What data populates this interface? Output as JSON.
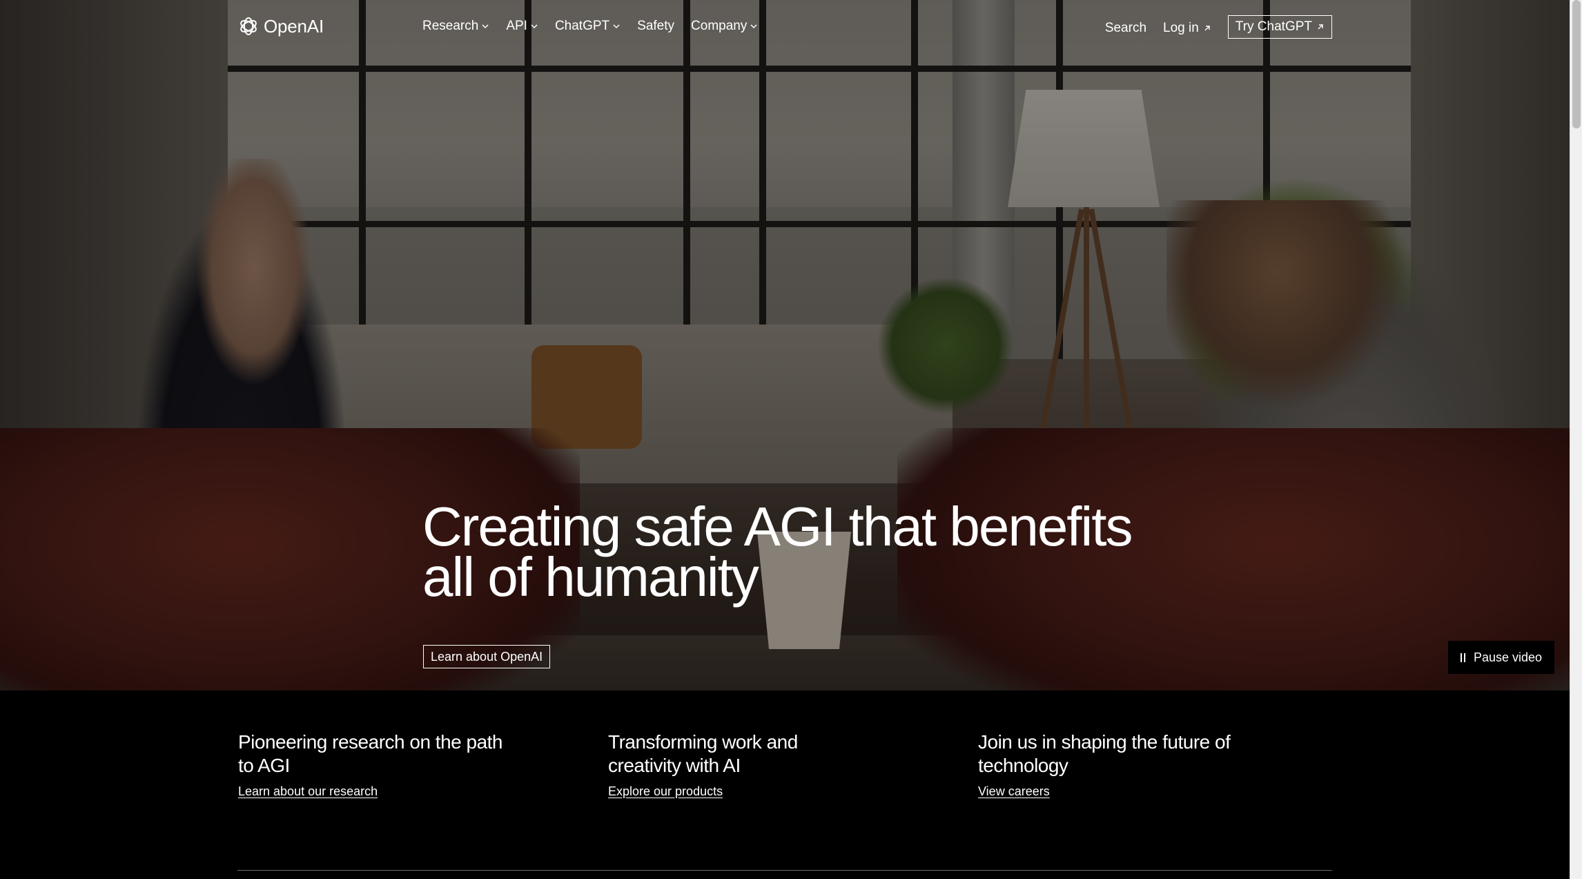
{
  "brand": {
    "name": "OpenAI",
    "logo_icon": "openai-knot-icon"
  },
  "nav": {
    "items": [
      {
        "label": "Research",
        "has_dropdown": true
      },
      {
        "label": "API",
        "has_dropdown": true
      },
      {
        "label": "ChatGPT",
        "has_dropdown": true
      },
      {
        "label": "Safety",
        "has_dropdown": false
      },
      {
        "label": "Company",
        "has_dropdown": true
      }
    ],
    "search_label": "Search",
    "login_label": "Log in",
    "try_label": "Try ChatGPT"
  },
  "hero": {
    "title": "Creating safe AGI that benefits all of humanity",
    "cta_label": "Learn about OpenAI",
    "pause_label": "Pause video"
  },
  "features": [
    {
      "heading": "Pioneering research on the path to AGI",
      "link": "Learn about our research"
    },
    {
      "heading": "Transforming work and creativity with AI",
      "link": "Explore our products"
    },
    {
      "heading": "Join us in shaping the future of technology",
      "link": "View careers"
    }
  ],
  "colors": {
    "background": "#000000",
    "text": "#ffffff"
  }
}
